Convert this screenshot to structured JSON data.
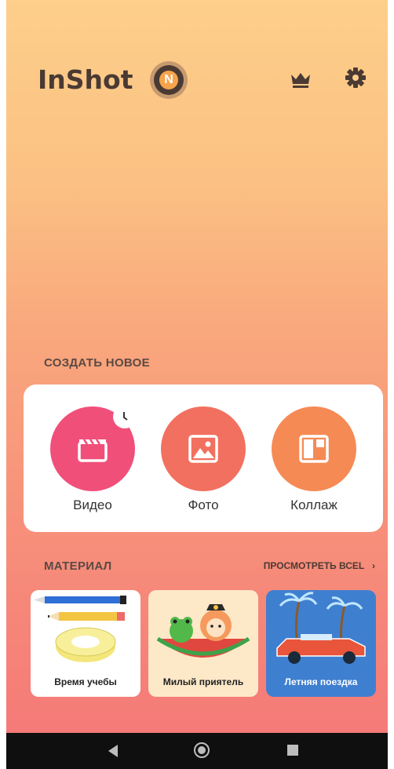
{
  "app": {
    "logo_text": "InShot",
    "badge_letter": "N"
  },
  "header": {
    "crown_icon": "crown-icon",
    "settings_icon": "gear-icon"
  },
  "create": {
    "title": "СОЗДАТЬ НОВОЕ",
    "tiles": [
      {
        "label": "Видео",
        "icon": "clapperboard-icon",
        "color": "#f04f7a"
      },
      {
        "label": "Фото",
        "icon": "image-icon",
        "color": "#f2705f"
      },
      {
        "label": "Коллаж",
        "icon": "collage-icon",
        "color": "#f58a55"
      }
    ]
  },
  "material": {
    "title": "МАТЕРИАЛ",
    "see_all": "ПРОСМОТРЕТЬ ВСЕL",
    "cards": [
      {
        "label": "Время учебы",
        "bg": "#ffffff"
      },
      {
        "label": "Милый приятель",
        "bg": "#fde8c8"
      },
      {
        "label": "Летняя поездка",
        "bg": "#3f7fd0"
      }
    ]
  },
  "navbar": {
    "back": "back-icon",
    "home": "home-icon",
    "recent": "recent-apps-icon"
  }
}
